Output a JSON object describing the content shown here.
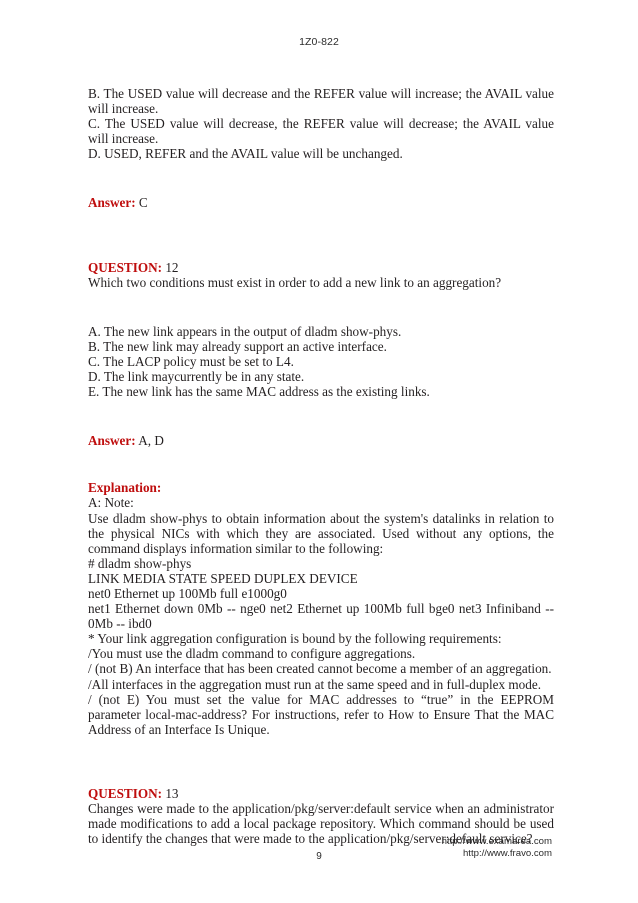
{
  "header": {
    "exam_code": "1Z0-822"
  },
  "answers_prev": {
    "option_b": "B. The USED value will decrease and the REFER value will increase; the AVAIL value will increase.",
    "option_c": "C. The USED value will decrease, the REFER value will decrease; the AVAIL value will increase.",
    "option_d": "D. USED, REFER and the AVAIL value will be unchanged.",
    "answer_label": "Answer:",
    "answer_value": "C"
  },
  "question12": {
    "question_label": "QUESTION:",
    "question_number": "12",
    "prompt": "Which two conditions must exist in order to add a new link to an aggregation?",
    "options": [
      "A. The new link appears in the output of dladm show-phys.",
      "B. The new link may already support an active interface.",
      "C. The LACP policy must be set to L4.",
      "D. The link maycurrently be in any state.",
      "E. The new link has the same MAC address as the existing links."
    ],
    "answer_label": "Answer:",
    "answer_value": "A, D",
    "explanation_label": "Explanation:",
    "explanation_lines": [
      "A: Note:",
      "Use dladm show-phys to obtain information about the system's datalinks in relation to the physical NICs with which they are associated. Used without any options, the command displays information similar to the following:",
      "# dladm show-phys",
      "LINK MEDIA STATE SPEED DUPLEX DEVICE",
      "net0 Ethernet up 100Mb full e1000g0",
      "net1 Ethernet down 0Mb -- nge0 net2 Ethernet up 100Mb full bge0 net3 Infiniband -- 0Mb -- ibd0",
      "* Your link aggregation configuration is bound by the following requirements:",
      "/You must use the dladm command to configure aggregations.",
      "/ (not B) An interface that has been created cannot become a member of an aggregation.",
      "/All interfaces in the aggregation must run at the same speed and in full-duplex mode.",
      "/ (not E) You must set the value for MAC addresses to “true” in the EEPROM parameter local-mac-address? For instructions, refer to How to Ensure That the MAC Address of an Interface Is Unique."
    ]
  },
  "question13": {
    "question_label": "QUESTION:",
    "question_number": "13",
    "prompt": "Changes were made to the application/pkg/server:default service when an administrator made modifications to add a local package repository. Which command should be used to identify the changes that were made to the application/pkg/server:default service?"
  },
  "footer": {
    "page_number": "9",
    "url_primary": "http://www.examarea.com",
    "url_secondary": "http://www.fravo.com"
  },
  "colors": {
    "accent_red": "#bf0d0d",
    "body_text": "#231f20",
    "page_background": "#ffffff"
  }
}
